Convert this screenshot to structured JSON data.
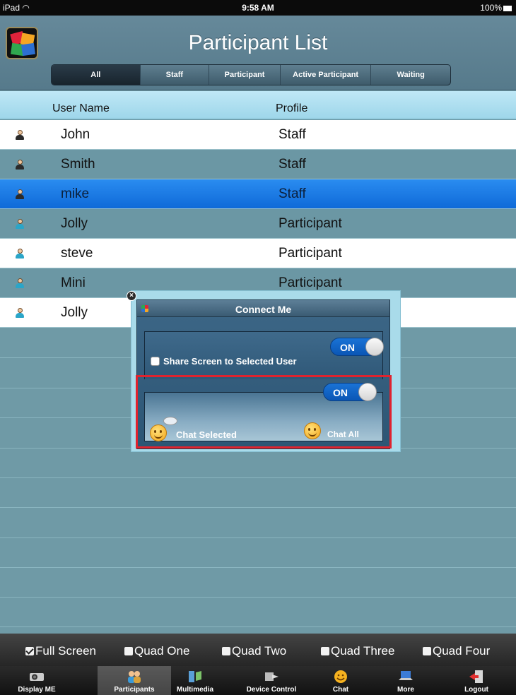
{
  "status_bar": {
    "device": "iPad",
    "wifi": "὏6",
    "time": "9:58 AM",
    "battery": "100%"
  },
  "header": {
    "title": "Participant List"
  },
  "filters": [
    "All",
    "Staff",
    "Participant",
    "Active Participant",
    "Waiting"
  ],
  "active_filter": "All",
  "columns": {
    "user_name": "User Name",
    "profile": "Profile"
  },
  "rows": [
    {
      "name": "John",
      "profile": "Staff"
    },
    {
      "name": "Smith",
      "profile": "Staff"
    },
    {
      "name": "mike",
      "profile": "Staff",
      "selected": true
    },
    {
      "name": "Jolly",
      "profile": "Participant"
    },
    {
      "name": "steve",
      "profile": "Participant"
    },
    {
      "name": "Mini",
      "profile": "Participant"
    },
    {
      "name": "Jolly",
      "profile": ""
    }
  ],
  "popup": {
    "title": "Connect Me",
    "close_icon": "close-icon",
    "share_toggle": "ON",
    "share_label": "Share Screen to Selected User",
    "chat_toggle": "ON",
    "chat_selected_label": "Chat Selected",
    "chat_all_label": "Chat All"
  },
  "options": [
    {
      "label": "Full Screen",
      "checked": true
    },
    {
      "label": "Quad One",
      "checked": false
    },
    {
      "label": "Quad Two",
      "checked": false
    },
    {
      "label": "Quad Three",
      "checked": false
    },
    {
      "label": "Quad Four",
      "checked": false
    }
  ],
  "tabs": [
    {
      "label": "Display ME",
      "icon": "projector-icon"
    },
    {
      "label": "Participants",
      "icon": "participants-icon",
      "active": true
    },
    {
      "label": "Multimedia",
      "icon": "multimedia-icon"
    },
    {
      "label": "Device Control",
      "icon": "device-control-icon"
    },
    {
      "label": "Chat",
      "icon": "smiley-icon"
    },
    {
      "label": "More",
      "icon": "laptop-icon"
    },
    {
      "label": "Logout",
      "icon": "logout-icon"
    }
  ],
  "colors": {
    "accent_blue": "#1a73d6",
    "highlight_red": "#e0232e",
    "selected_row": "#1a7ae8"
  }
}
